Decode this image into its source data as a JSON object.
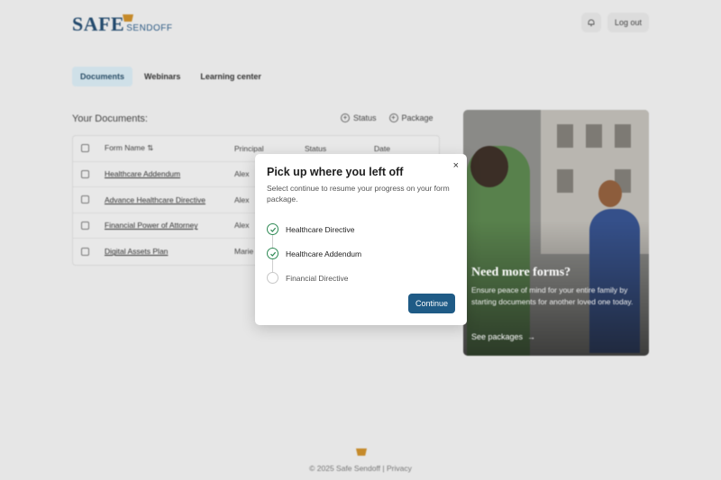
{
  "brand": {
    "name": "SAFE",
    "sub": "SENDOFF"
  },
  "header": {
    "logout_label": "Log out",
    "bell_icon": "bell-icon"
  },
  "tabs": [
    {
      "label": "Documents",
      "active": true
    },
    {
      "label": "Webinars",
      "active": false
    },
    {
      "label": "Learning center",
      "active": false
    }
  ],
  "documents": {
    "title": "Your Documents:",
    "filters": [
      {
        "label": "Status"
      },
      {
        "label": "Package"
      }
    ],
    "columns": [
      "Form Name",
      "Principal",
      "Status",
      "Date"
    ],
    "rows": [
      {
        "name": "Healthcare Addendum",
        "principal": "Alex"
      },
      {
        "name": "Advance Healthcare Directive",
        "principal": "Alex"
      },
      {
        "name": "Financial Power of Attorney",
        "principal": "Alex"
      },
      {
        "name": "Digital Assets Plan",
        "principal": "Marie"
      }
    ]
  },
  "promo": {
    "title": "Need more forms?",
    "description": "Ensure peace of mind for your entire family by starting documents for another loved one today.",
    "link": "See packages"
  },
  "footer": {
    "text": "© 2025 Safe Sendoff | Privacy"
  },
  "modal": {
    "title": "Pick up where you left off",
    "description": "Select continue to resume your progress on your form package.",
    "steps": [
      {
        "label": "Healthcare Directive",
        "done": true
      },
      {
        "label": "Healthcare Addendum",
        "done": true
      },
      {
        "label": "Financial Directive",
        "done": false
      }
    ],
    "continue_label": "Continue",
    "close_symbol": "×"
  },
  "colors": {
    "primary": "#1f5b86",
    "success": "#2f8a55",
    "brand": "#234a6d",
    "accent": "#c58a2a"
  }
}
